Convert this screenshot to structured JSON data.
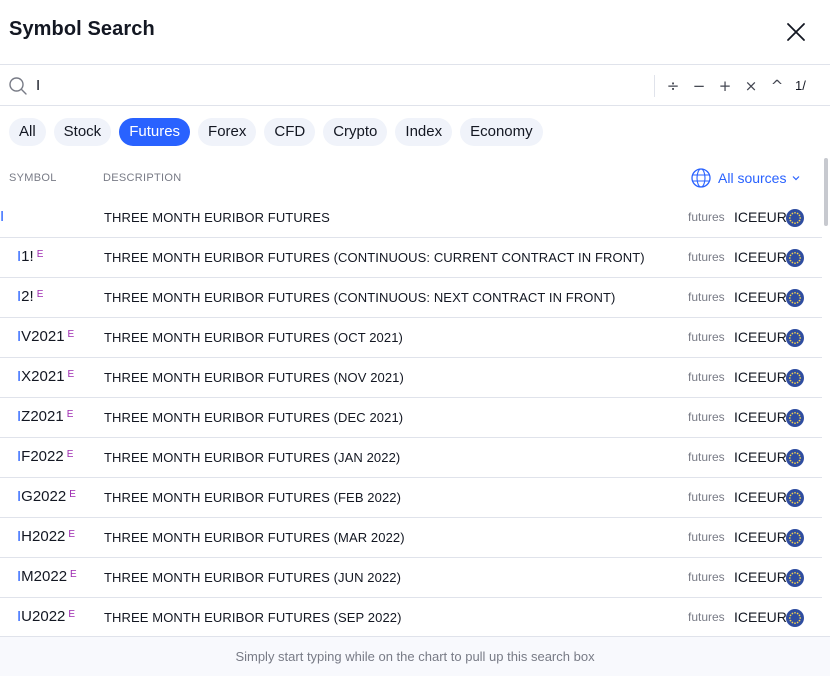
{
  "header": {
    "title": "Symbol Search"
  },
  "search": {
    "value": "I",
    "operators": [
      "÷",
      "−",
      "+",
      "×",
      "^"
    ],
    "fraction": "1/"
  },
  "tabs": [
    {
      "label": "All",
      "active": false
    },
    {
      "label": "Stock",
      "active": false
    },
    {
      "label": "Futures",
      "active": true
    },
    {
      "label": "Forex",
      "active": false
    },
    {
      "label": "CFD",
      "active": false
    },
    {
      "label": "Crypto",
      "active": false
    },
    {
      "label": "Index",
      "active": false
    },
    {
      "label": "Economy",
      "active": false
    }
  ],
  "columns": {
    "symbol": "SYMBOL",
    "description": "DESCRIPTION",
    "sources": "All sources"
  },
  "rows": [
    {
      "highlight": "I",
      "rest": "",
      "badge": "",
      "description": "THREE MONTH EURIBOR FUTURES",
      "type": "futures",
      "exchange": "ICEEUR"
    },
    {
      "highlight": "I",
      "rest": "1!",
      "badge": "E",
      "description": "THREE MONTH EURIBOR FUTURES (CONTINUOUS: CURRENT CONTRACT IN FRONT)",
      "type": "futures",
      "exchange": "ICEEUR"
    },
    {
      "highlight": "I",
      "rest": "2!",
      "badge": "E",
      "description": "THREE MONTH EURIBOR FUTURES (CONTINUOUS: NEXT CONTRACT IN FRONT)",
      "type": "futures",
      "exchange": "ICEEUR"
    },
    {
      "highlight": "I",
      "rest": "V2021",
      "badge": "E",
      "description": "THREE MONTH EURIBOR FUTURES (OCT 2021)",
      "type": "futures",
      "exchange": "ICEEUR"
    },
    {
      "highlight": "I",
      "rest": "X2021",
      "badge": "E",
      "description": "THREE MONTH EURIBOR FUTURES (NOV 2021)",
      "type": "futures",
      "exchange": "ICEEUR"
    },
    {
      "highlight": "I",
      "rest": "Z2021",
      "badge": "E",
      "description": "THREE MONTH EURIBOR FUTURES (DEC 2021)",
      "type": "futures",
      "exchange": "ICEEUR"
    },
    {
      "highlight": "I",
      "rest": "F2022",
      "badge": "E",
      "description": "THREE MONTH EURIBOR FUTURES (JAN 2022)",
      "type": "futures",
      "exchange": "ICEEUR"
    },
    {
      "highlight": "I",
      "rest": "G2022",
      "badge": "E",
      "description": "THREE MONTH EURIBOR FUTURES (FEB 2022)",
      "type": "futures",
      "exchange": "ICEEUR"
    },
    {
      "highlight": "I",
      "rest": "H2022",
      "badge": "E",
      "description": "THREE MONTH EURIBOR FUTURES (MAR 2022)",
      "type": "futures",
      "exchange": "ICEEUR"
    },
    {
      "highlight": "I",
      "rest": "M2022",
      "badge": "E",
      "description": "THREE MONTH EURIBOR FUTURES (JUN 2022)",
      "type": "futures",
      "exchange": "ICEEUR"
    },
    {
      "highlight": "I",
      "rest": "U2022",
      "badge": "E",
      "description": "THREE MONTH EURIBOR FUTURES (SEP 2022)",
      "type": "futures",
      "exchange": "ICEEUR"
    }
  ],
  "footer": {
    "hint": "Simply start typing while on the chart to pull up this search box"
  },
  "colors": {
    "accent": "#2962ff",
    "badge": "#9c27b0",
    "flag": "#2f4da0",
    "flag_stars": "#f7d54a"
  },
  "icons": {
    "close": "close-icon",
    "search": "search-icon",
    "globe": "globe-icon",
    "flag": "eu-flag-icon",
    "chevron": "chevron-down-icon"
  }
}
